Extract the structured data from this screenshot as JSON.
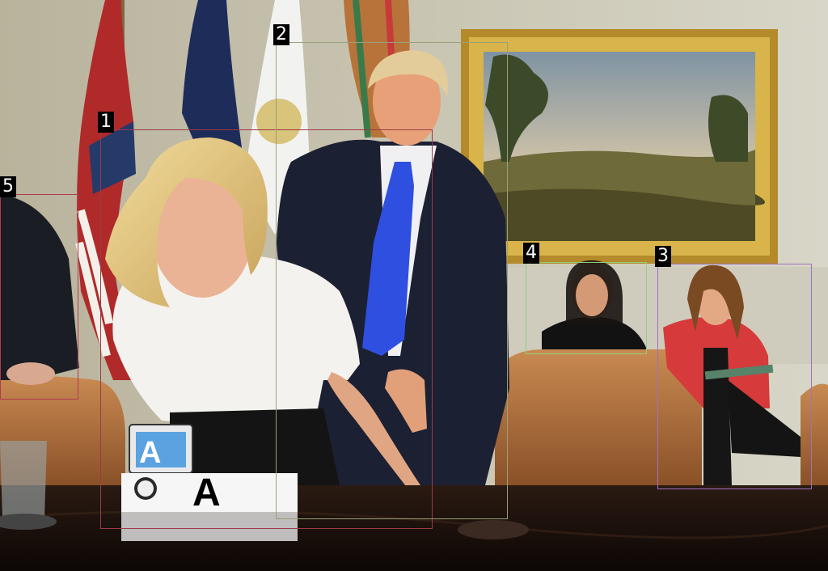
{
  "scene": {
    "placard_letter": "A",
    "badge_letter": "A"
  },
  "annotations": [
    {
      "id": "1",
      "color": "#9c3a48"
    },
    {
      "id": "2",
      "color": "#9aa07a"
    },
    {
      "id": "3",
      "color": "#a070c0"
    },
    {
      "id": "4",
      "color": "#8fd07a"
    },
    {
      "id": "5",
      "color": "#b03a50"
    }
  ]
}
